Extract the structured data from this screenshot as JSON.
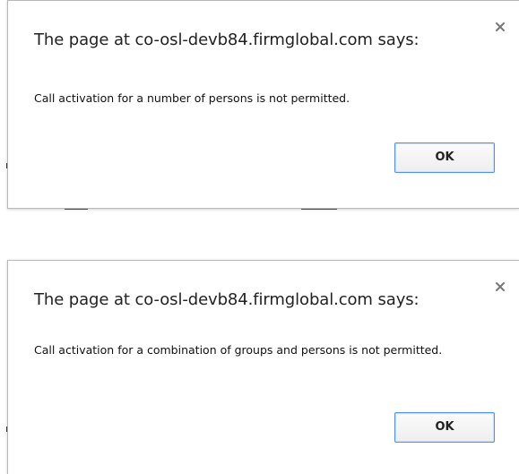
{
  "dialogs": [
    {
      "title": "The page at co-osl-devb84.firmglobal.com says:",
      "message": "Call activation for a number of persons is not permitted.",
      "ok_label": "OK",
      "close_icon": "close-icon"
    },
    {
      "title": "The page at co-osl-devb84.firmglobal.com says:",
      "message": "Call activation for a combination of groups and persons is not permitted.",
      "ok_label": "OK",
      "close_icon": "close-icon"
    }
  ],
  "colors": {
    "ok_border": "#4d90fe",
    "dialog_border": "#b9b9b9"
  }
}
